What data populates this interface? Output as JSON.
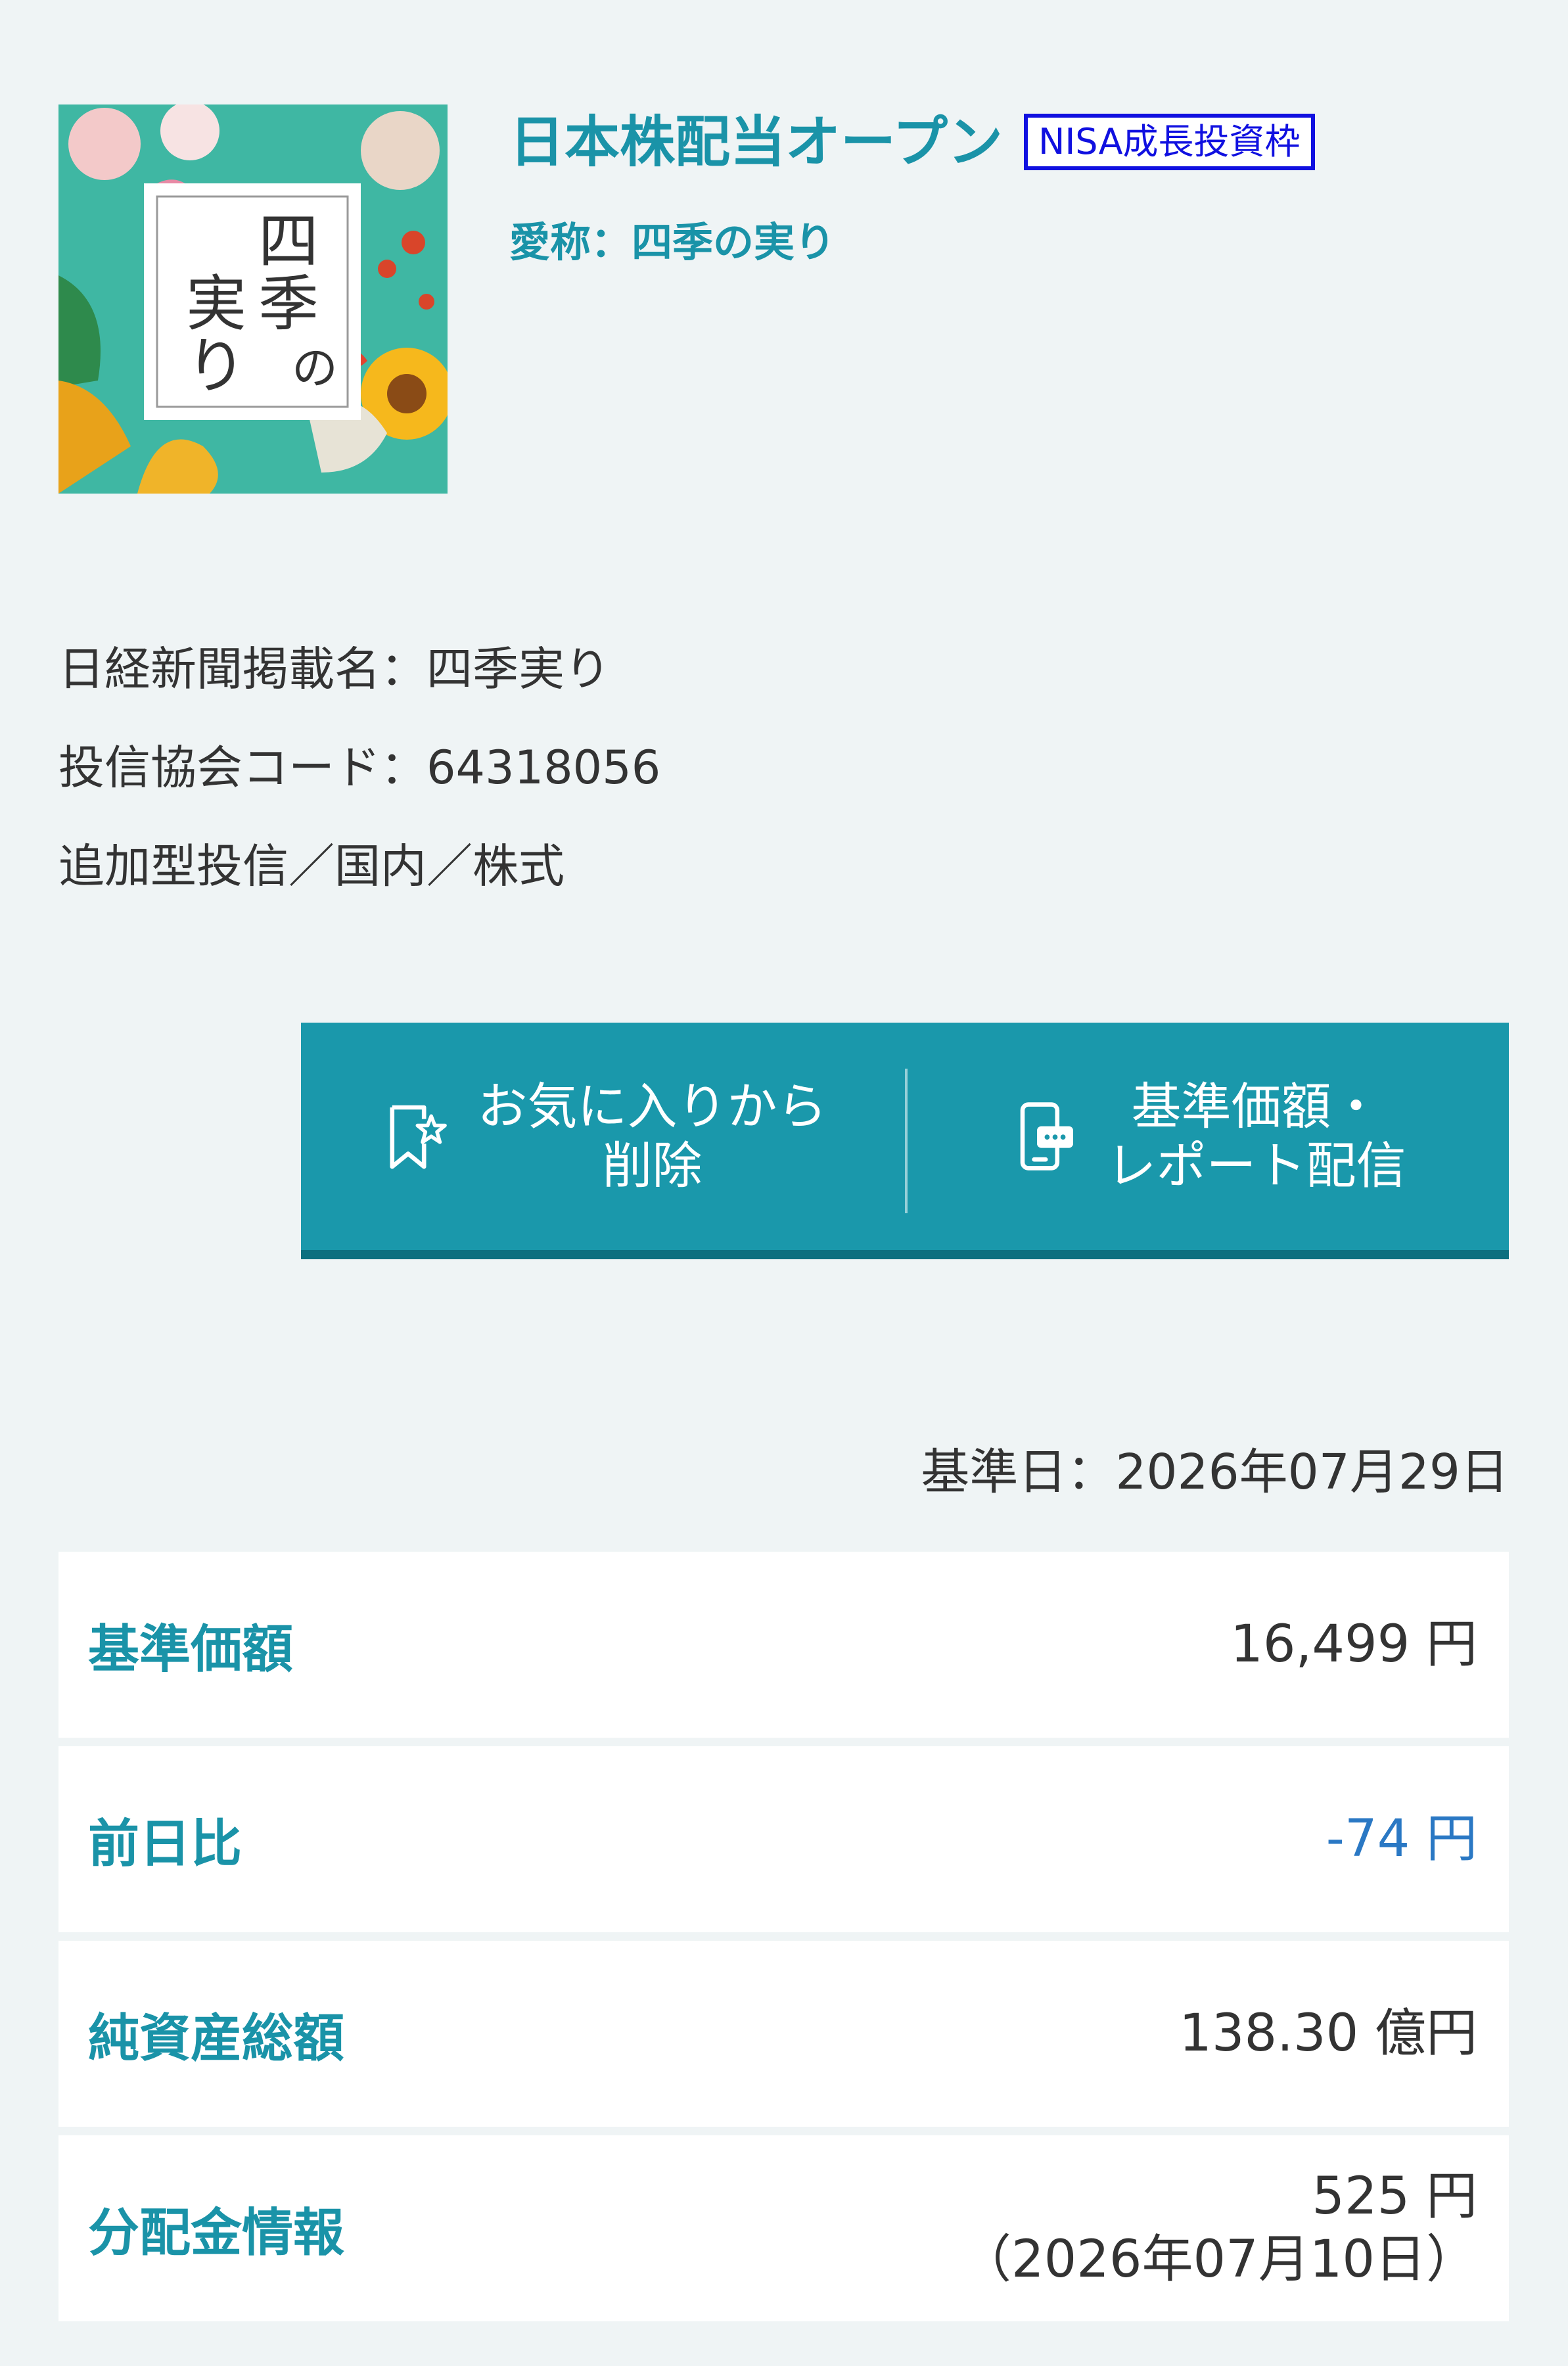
{
  "fund": {
    "name": "日本株配当オープン",
    "badge": "NISA成長投資枠",
    "nickname": "愛称：四季の実り",
    "logo_text": "四季の実り"
  },
  "meta": {
    "nikkei_name": "日経新聞掲載名：四季実り",
    "association_code": "投信協会コード：64318056",
    "category": "追加型投信／国内／株式"
  },
  "actions": {
    "favorite_line1": "お気に入りから",
    "favorite_line2": "削除",
    "report_line1": "基準価額・",
    "report_line2": "レポート配信"
  },
  "base_date": "基準日：2026年07月29日",
  "rows": [
    {
      "label": "基準価額",
      "value": "16,499 円"
    },
    {
      "label": "前日比",
      "value": "-74 円"
    },
    {
      "label": "純資産総額",
      "value": "138.30 億円"
    },
    {
      "label": "分配金情報",
      "value": "525 円",
      "sub": "（2026年07月10日）"
    }
  ],
  "colors": {
    "accent": "#1a93a8",
    "action_bar": "#1a98ab",
    "badge": "#1010e0",
    "negative": "#2a78c4",
    "background": "#eff4f5"
  },
  "icons": {
    "favorite": "bookmark-star-icon",
    "report": "phone-message-icon"
  }
}
